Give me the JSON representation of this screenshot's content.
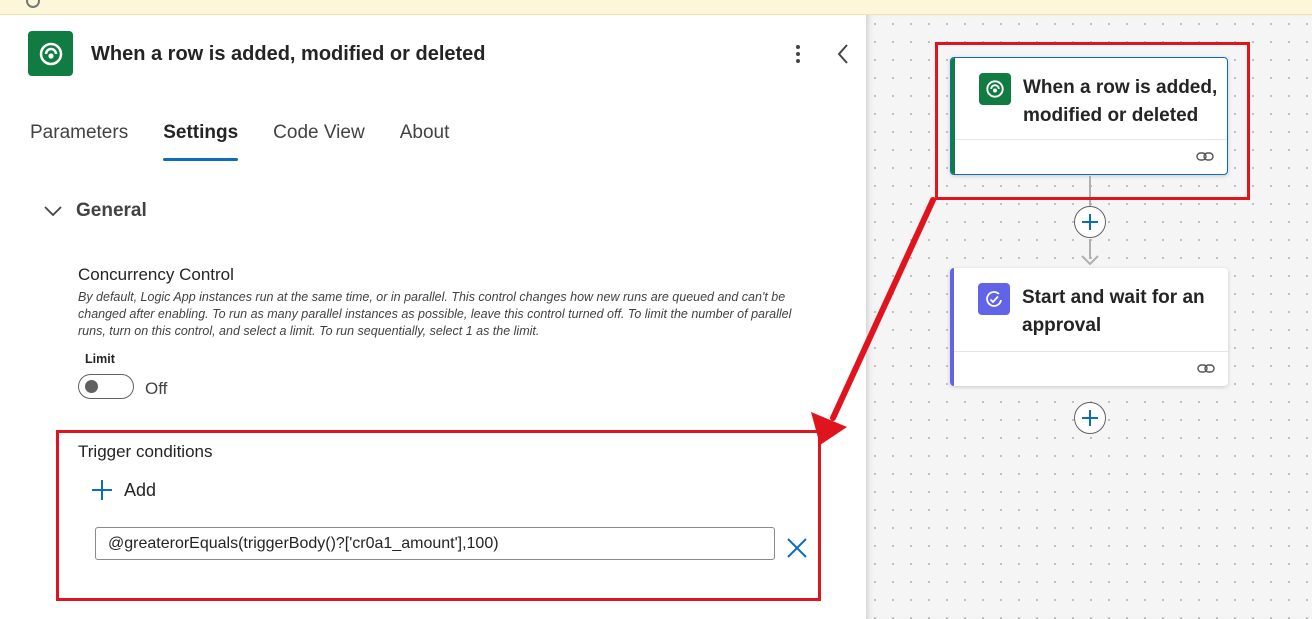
{
  "panel": {
    "title": "When a row is added, modified or deleted",
    "tabs": [
      {
        "label": "Parameters"
      },
      {
        "label": "Settings"
      },
      {
        "label": "Code View"
      },
      {
        "label": "About"
      }
    ],
    "active_tab": "Settings"
  },
  "general": {
    "section_label": "General",
    "concurrency": {
      "title": "Concurrency Control",
      "description": "By default, Logic App instances run at the same time, or in parallel. This control changes how new runs are queued and can't be changed after enabling. To run as many parallel instances as possible, leave this control turned off. To limit the number of parallel runs, turn on this control, and select a limit. To run sequentially, select 1 as the limit.",
      "limit_label": "Limit",
      "toggle_state": "Off"
    },
    "trigger_conditions": {
      "title": "Trigger conditions",
      "add_label": "Add",
      "condition_value": "@greaterorEquals(triggerBody()?['cr0a1_amount'],100)"
    }
  },
  "canvas": {
    "nodes": [
      {
        "title": "When a row is added, modified or deleted",
        "icon": "dataverse-icon",
        "accent": "#107c41"
      },
      {
        "title": "Start and wait for an approval",
        "icon": "approval-icon",
        "accent": "#6264e7"
      }
    ]
  },
  "colors": {
    "brand_green": "#107c41",
    "approval_purple": "#6264e7",
    "tab_underline": "#0f6cbd",
    "annotation_red": "#e0141e"
  }
}
